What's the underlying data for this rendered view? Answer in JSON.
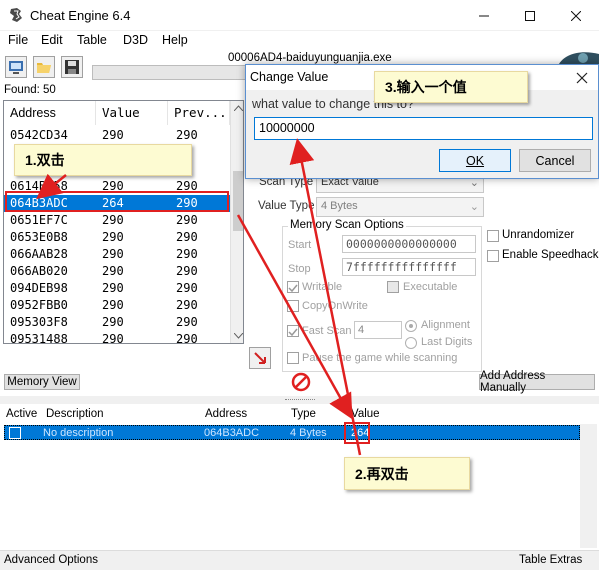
{
  "window": {
    "title": "Cheat Engine 6.4",
    "process": "00006AD4-baiduyunguanjia.exe"
  },
  "menu": [
    "File",
    "Edit",
    "Table",
    "D3D",
    "Help"
  ],
  "found_label": "Found: 50",
  "address_list": {
    "columns": [
      "Address",
      "Value",
      "Prev..."
    ],
    "rows": [
      [
        "0542CD34",
        "290",
        "290"
      ],
      [
        "",
        "",
        ""
      ],
      [
        "",
        "",
        ""
      ],
      [
        "0614B558",
        "290",
        "290"
      ],
      [
        "064B3ADC",
        "264",
        "290"
      ],
      [
        "0651EF7C",
        "290",
        "290"
      ],
      [
        "0653E0B8",
        "290",
        "290"
      ],
      [
        "066AAB28",
        "290",
        "290"
      ],
      [
        "066AB020",
        "290",
        "290"
      ],
      [
        "094DEB98",
        "290",
        "290"
      ],
      [
        "0952FBB0",
        "290",
        "290"
      ],
      [
        "095303F8",
        "290",
        "290"
      ],
      [
        "09531488",
        "290",
        "290"
      ]
    ],
    "selected_index": 4
  },
  "scan_panel": {
    "scan_type_label": "Scan Type",
    "scan_type_value": "Exact Value",
    "value_type_label": "Value Type",
    "value_type_value": "4 Bytes",
    "memory_options_title": "Memory Scan Options",
    "start_label": "Start",
    "start_value": "0000000000000000",
    "stop_label": "Stop",
    "stop_value": "7fffffffffffffff",
    "writable": "Writable",
    "executable": "Executable",
    "copy_on_write": "CopyOnWrite",
    "fast_scan": "Fast Scan",
    "fast_scan_value": "4",
    "alignment": "Alignment",
    "last_digits": "Last Digits",
    "pause_game": "Pause the game while scanning",
    "unrandomizer": "Unrandomizer",
    "enable_speedhack": "Enable Speedhack"
  },
  "memory_view_button": "Memory View",
  "add_address_button": "Add Address Manually",
  "cheat_table": {
    "columns": [
      "Active",
      "Description",
      "Address",
      "Type",
      "Value"
    ],
    "row": {
      "description": "No description",
      "address": "064B3ADC",
      "type": "4 Bytes",
      "value": "264"
    }
  },
  "status": {
    "left": "Advanced Options",
    "right": "Table Extras"
  },
  "dialog": {
    "title": "Change Value",
    "prompt": "what value to change this to?",
    "input_value": "10000000",
    "ok_label": "OK",
    "cancel_label": "Cancel"
  },
  "callouts": {
    "step1": "1.双击",
    "step2": "2.再双击",
    "step3": "3.输入一个值"
  },
  "colors": {
    "selection": "#0078d7",
    "annotation_red": "#e02020",
    "callout_bg": "#fdfbd2"
  }
}
